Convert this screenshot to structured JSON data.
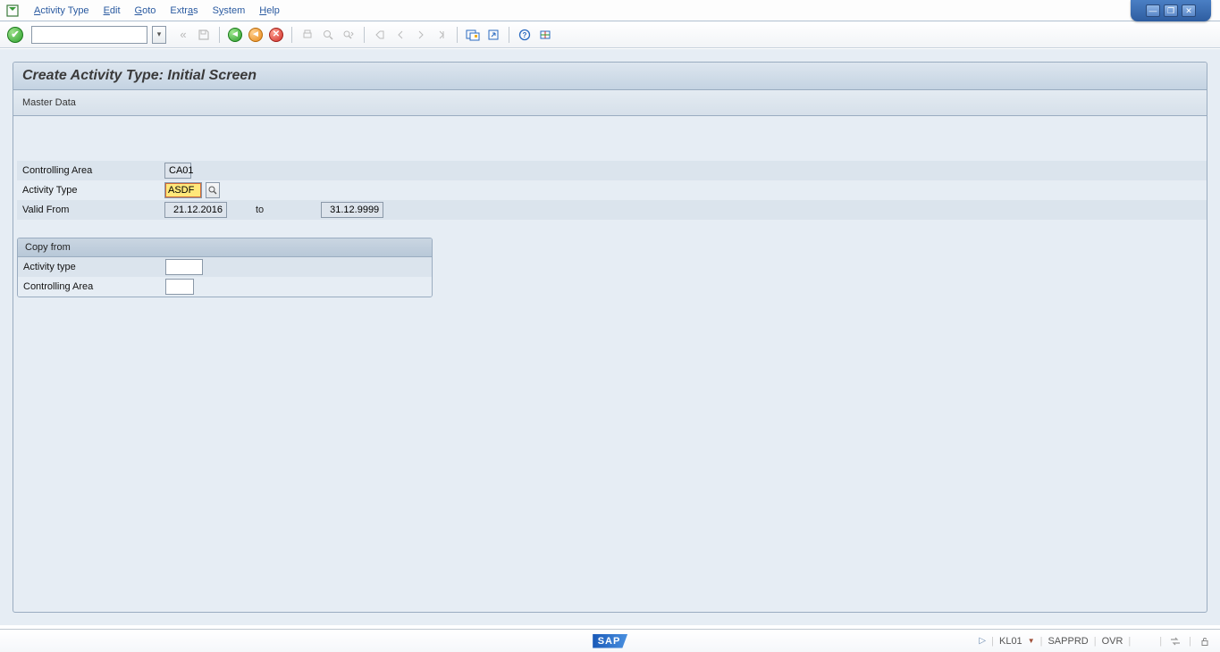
{
  "menu": {
    "items": [
      {
        "pre": "",
        "u": "A",
        "post": "ctivity Type"
      },
      {
        "pre": "",
        "u": "E",
        "post": "dit"
      },
      {
        "pre": "",
        "u": "G",
        "post": "oto"
      },
      {
        "pre": "Extr",
        "u": "a",
        "post": "s"
      },
      {
        "pre": "S",
        "u": "y",
        "post": "stem"
      },
      {
        "pre": "",
        "u": "H",
        "post": "elp"
      }
    ]
  },
  "toolbar": {
    "cmd_value": "",
    "chev_left": "«"
  },
  "screen": {
    "title": "Create Activity Type: Initial Screen",
    "subtitle": "Master Data"
  },
  "form": {
    "controlling_area_label": "Controlling Area",
    "controlling_area_value": "CA01",
    "activity_type_label": "Activity Type",
    "activity_type_value": "ASDF",
    "valid_from_label": "Valid From",
    "valid_from_value": "21.12.2016",
    "to_label": "to",
    "valid_to_value": "31.12.9999"
  },
  "copy_from": {
    "group_title": "Copy from",
    "activity_type_label": "Activity type",
    "activity_type_value": "",
    "controlling_area_label": "Controlling Area",
    "controlling_area_value": ""
  },
  "status": {
    "sap": "SAP",
    "tcode": "KL01",
    "system": "SAPPRD",
    "insmode": "OVR"
  }
}
